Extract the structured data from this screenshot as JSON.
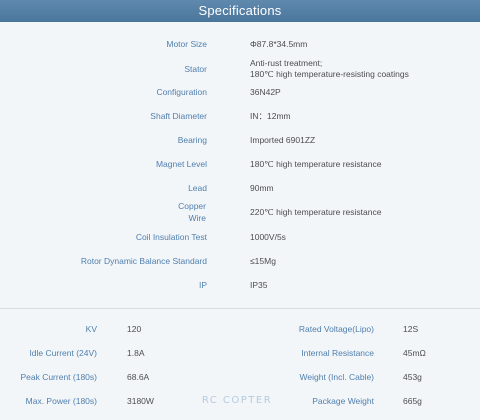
{
  "header": {
    "title": "Specifications"
  },
  "specs": [
    {
      "label": "Motor Size",
      "value_lines": [
        "Φ87.8*34.5mm"
      ]
    },
    {
      "label": "Stator",
      "value_lines": [
        "Anti-rust treatment;",
        "180℃ high temperature-resisting coatings"
      ]
    },
    {
      "label": "Configuration",
      "value_lines": [
        "36N42P"
      ]
    },
    {
      "label": "Shaft Diameter",
      "value_lines": [
        "IN：12mm"
      ]
    },
    {
      "label": "Bearing",
      "value_lines": [
        "Imported 6901ZZ"
      ]
    },
    {
      "label": "Magnet Level",
      "value_lines": [
        "180℃ high temperature resistance"
      ]
    },
    {
      "label": "Lead",
      "value_lines": [
        "90mm"
      ]
    },
    {
      "label_lines": [
        "Copper",
        "Wire"
      ],
      "value_lines": [
        "220℃ high temperature resistance"
      ]
    },
    {
      "label": "Coil Insulation Test",
      "value_lines": [
        "1000V/5s"
      ]
    },
    {
      "label": "Rotor Dynamic Balance Standard",
      "value_lines": [
        "≤15Mg"
      ]
    },
    {
      "label": "IP",
      "value_lines": [
        "IP35"
      ]
    }
  ],
  "params": {
    "left": [
      {
        "label": "KV",
        "value": "120"
      },
      {
        "label": "Idle Current  (24V)",
        "value": "1.8A"
      },
      {
        "label": "Peak Current  (180s)",
        "value": "68.6A"
      },
      {
        "label": "Max. Power  (180s)",
        "value": "3180W"
      }
    ],
    "right": [
      {
        "label": "Rated Voltage(Lipo)",
        "value": "12S"
      },
      {
        "label": "Internal Resistance",
        "value": "45mΩ"
      },
      {
        "label": "Weight (Incl. Cable)",
        "value": "453g"
      },
      {
        "label": "Package Weight",
        "value": "665g"
      }
    ]
  },
  "watermark": {
    "text": "RC COPTER"
  }
}
